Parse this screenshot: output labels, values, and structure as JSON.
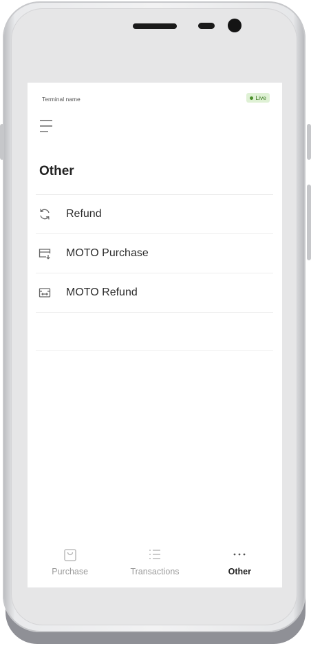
{
  "status_bar": {
    "terminal_name": "Terminal name",
    "live_badge": "Live"
  },
  "page": {
    "title": "Other"
  },
  "menu": {
    "items": [
      {
        "label": "Refund",
        "icon": "refresh-icon"
      },
      {
        "label": "MOTO Purchase",
        "icon": "card-download-icon"
      },
      {
        "label": "MOTO Refund",
        "icon": "card-exchange-icon"
      }
    ]
  },
  "bottom_nav": {
    "items": [
      {
        "label": "Purchase",
        "icon": "shopping-bag-icon",
        "active": false
      },
      {
        "label": "Transactions",
        "icon": "list-icon",
        "active": false
      },
      {
        "label": "Other",
        "icon": "more-dots-icon",
        "active": true
      }
    ]
  },
  "colors": {
    "live_bg": "#dff1d5",
    "live_text": "#3c7a22",
    "active_nav": "#222222",
    "inactive_nav": "#9a9a9a"
  }
}
